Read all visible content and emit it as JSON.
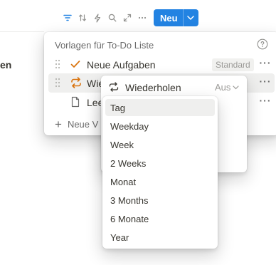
{
  "background": {
    "left_text": "en"
  },
  "toolbar": {
    "icons": [
      "filter-icon",
      "sort-icon",
      "automation-icon",
      "search-icon",
      "expand-icon",
      "more-icon"
    ],
    "new_label": "Neu",
    "accent": "#2383e2"
  },
  "templates": {
    "title": "Vorlagen für To-Do Liste",
    "rows": [
      {
        "label": "Neue Aufgaben",
        "icon": "check-icon",
        "badge": "Standard",
        "more": "···"
      },
      {
        "label": "Wie",
        "icon": "repeat-icon",
        "more": "···"
      },
      {
        "label": "Lee",
        "icon": "page-icon",
        "more": "···"
      }
    ],
    "new_label": "Neue V",
    "icon_color": "#d9730d"
  },
  "repeat": {
    "label": "Wiederholen",
    "value": "Aus"
  },
  "dropdown": {
    "selected": "Tag",
    "options": [
      "Tag",
      "Weekday",
      "Week",
      "2 Weeks",
      "Monat",
      "3 Months",
      "6 Monate",
      "Year"
    ]
  }
}
